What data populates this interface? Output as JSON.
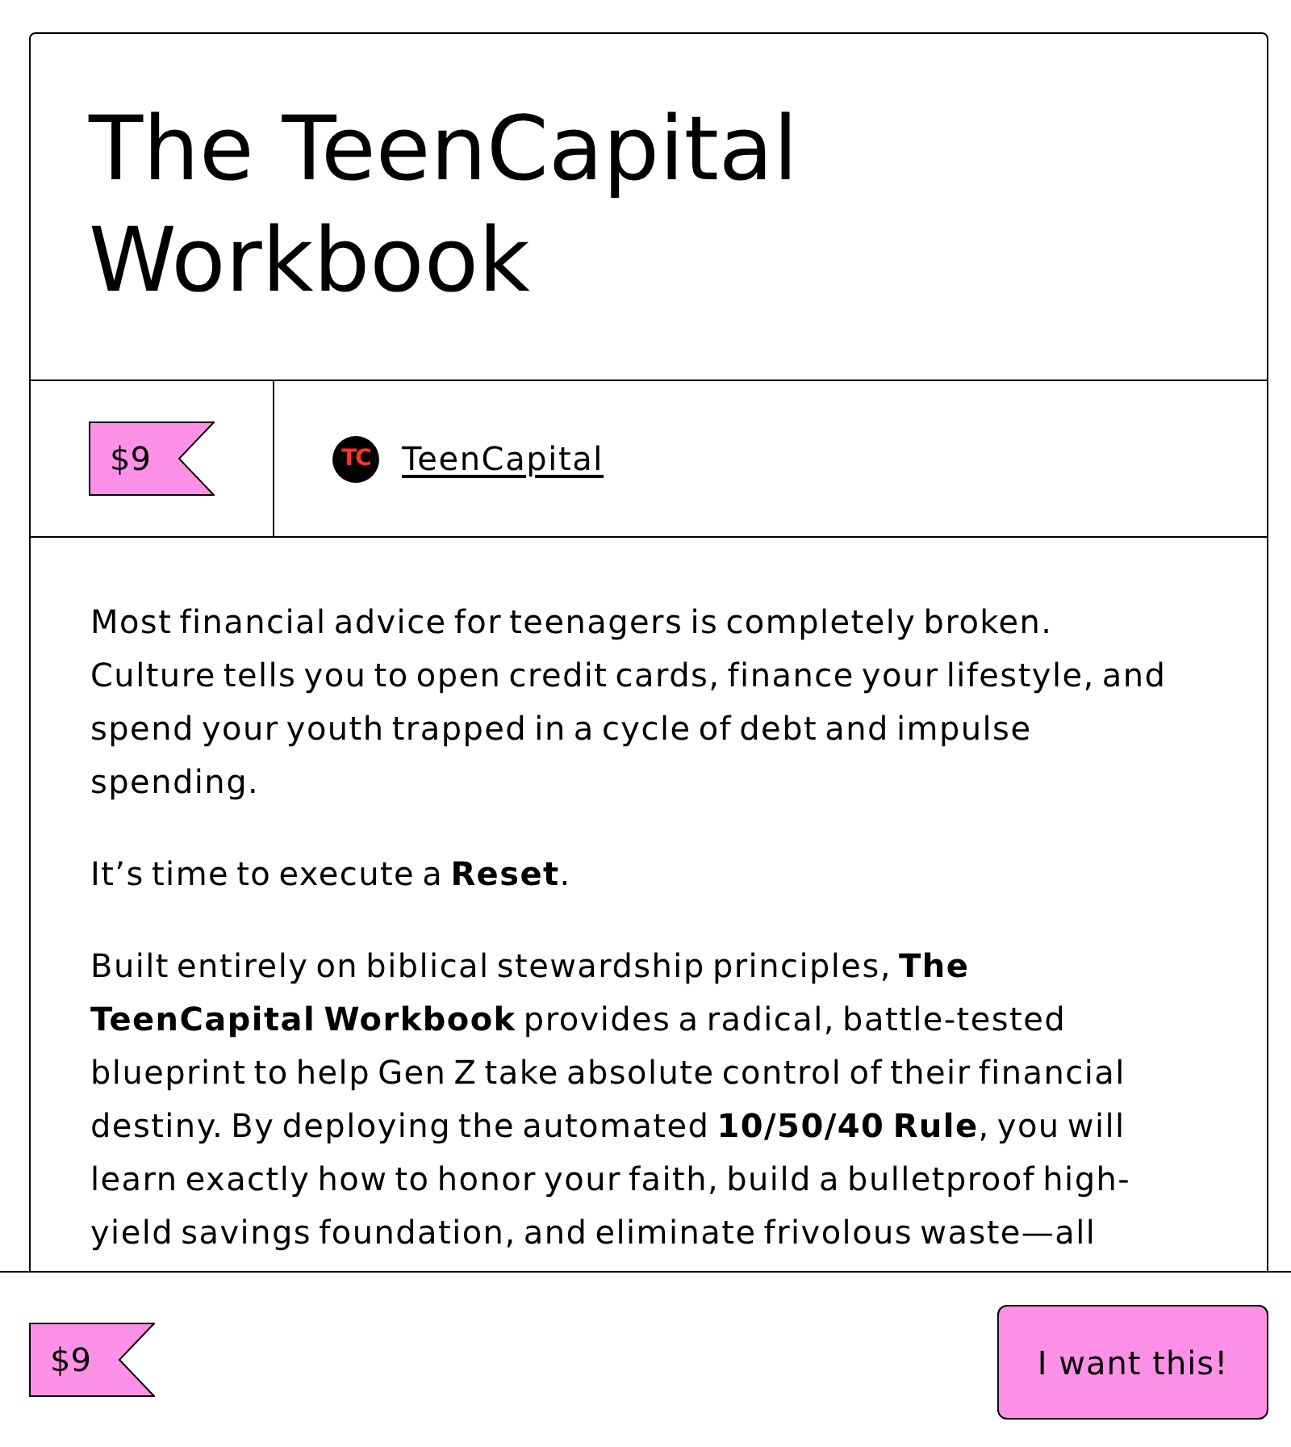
{
  "product": {
    "title": "The TeenCapital Workbook"
  },
  "meta": {
    "price": "$9",
    "creator": {
      "logo_text": "TC",
      "name": "TeenCapital"
    }
  },
  "description": [
    "Most financial advice for teenagers is completely broken. Culture tells you to open credit cards, finance your lifestyle, and spend your youth trapped in a cycle of debt and impulse spending.",
    "It’s time to execute a **Reset**.",
    "Built entirely on biblical stewardship principles, **The TeenCapital Workbook** provides a radical, battle-tested blueprint to help Gen Z take absolute control of their financial destiny. By deploying the automated **10/50/40 Rule**, you will learn exactly how to honor your faith, build a bulletproof high-yield savings foundation, and eliminate frivolous waste—all"
  ],
  "footer": {
    "price": "$9",
    "button": "I want this!"
  }
}
